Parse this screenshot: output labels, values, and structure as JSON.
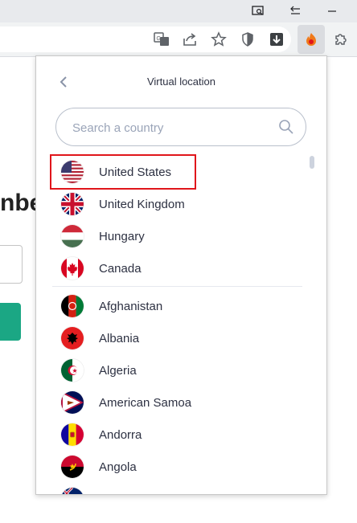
{
  "browser": {
    "titlebar_icons": [
      "tab-search-icon",
      "restore-icon",
      "minimize-icon"
    ],
    "toolbar_icons": [
      "translate-icon",
      "share-icon",
      "bookmark-star-icon",
      "shield-icon",
      "download-icon",
      "vpn-extension-icon",
      "extensions-puzzle-icon"
    ]
  },
  "background_page": {
    "heading_fragment": "nbe"
  },
  "popup": {
    "title": "Virtual location",
    "search_placeholder": "Search a country",
    "highlighted_country": "United States",
    "favorites": [
      {
        "label": "United States",
        "flag": "us-flag-icon"
      },
      {
        "label": "United Kingdom",
        "flag": "uk-flag-icon"
      },
      {
        "label": "Hungary",
        "flag": "hungary-flag-icon"
      },
      {
        "label": "Canada",
        "flag": "canada-flag-icon"
      }
    ],
    "countries": [
      {
        "label": "Afghanistan",
        "flag": "afghanistan-flag-icon"
      },
      {
        "label": "Albania",
        "flag": "albania-flag-icon"
      },
      {
        "label": "Algeria",
        "flag": "algeria-flag-icon"
      },
      {
        "label": "American Samoa",
        "flag": "american-samoa-flag-icon"
      },
      {
        "label": "Andorra",
        "flag": "andorra-flag-icon"
      },
      {
        "label": "Angola",
        "flag": "angola-flag-icon"
      }
    ],
    "colors": {
      "highlight_border": "#e0151b",
      "text": "#2d3142",
      "placeholder": "#9aa4b8"
    }
  }
}
